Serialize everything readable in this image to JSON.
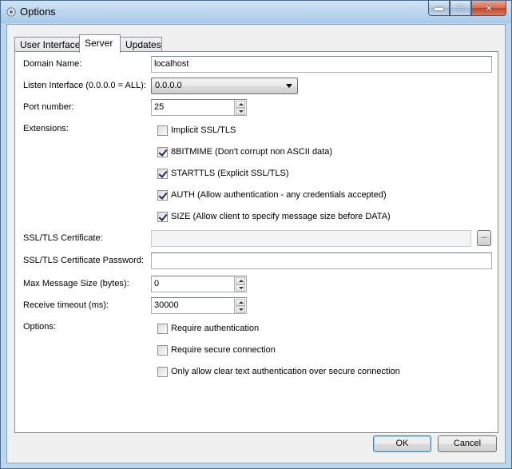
{
  "window": {
    "title": "Options"
  },
  "tabs": [
    {
      "label": "User Interface",
      "active": false
    },
    {
      "label": "Server",
      "active": true
    },
    {
      "label": "Updates",
      "active": false
    }
  ],
  "fields": {
    "domain_name": {
      "label": "Domain Name:",
      "value": "localhost"
    },
    "listen_interface": {
      "label": "Listen Interface (0.0.0.0 = ALL):",
      "value": "0.0.0.0"
    },
    "port_number": {
      "label": "Port number:",
      "value": "25"
    },
    "extensions_label": "Extensions:",
    "ssl_certificate": {
      "label": "SSL/TLS Certificate:",
      "value": "",
      "browse_label": "..."
    },
    "ssl_certificate_password": {
      "label": "SSL/TLS Certificate Password:",
      "value": ""
    },
    "max_message_size": {
      "label": "Max Message Size (bytes):",
      "value": "0"
    },
    "receive_timeout": {
      "label": "Receive timeout (ms):",
      "value": "30000"
    },
    "options_label": "Options:"
  },
  "extensions": [
    {
      "label": "Implicit SSL/TLS",
      "checked": false
    },
    {
      "label": "8BITMIME (Don't corrupt non ASCII data)",
      "checked": true
    },
    {
      "label": "STARTTLS (Explicit SSL/TLS)",
      "checked": true
    },
    {
      "label": "AUTH (Allow authentication - any credentials accepted)",
      "checked": true
    },
    {
      "label": "SIZE (Allow client to specify message size before DATA)",
      "checked": true
    }
  ],
  "options": [
    {
      "label": "Require authentication",
      "checked": false
    },
    {
      "label": "Require secure connection",
      "checked": false
    },
    {
      "label": "Only allow clear text authentication over secure connection",
      "checked": false
    }
  ],
  "buttons": {
    "ok": "OK",
    "cancel": "Cancel"
  },
  "colors": {
    "titlebar": "#a9c9e8",
    "close_button": "#c2462b",
    "default_button_border": "#3c7fb1"
  },
  "icons": {
    "title": "options-gear-icon"
  }
}
